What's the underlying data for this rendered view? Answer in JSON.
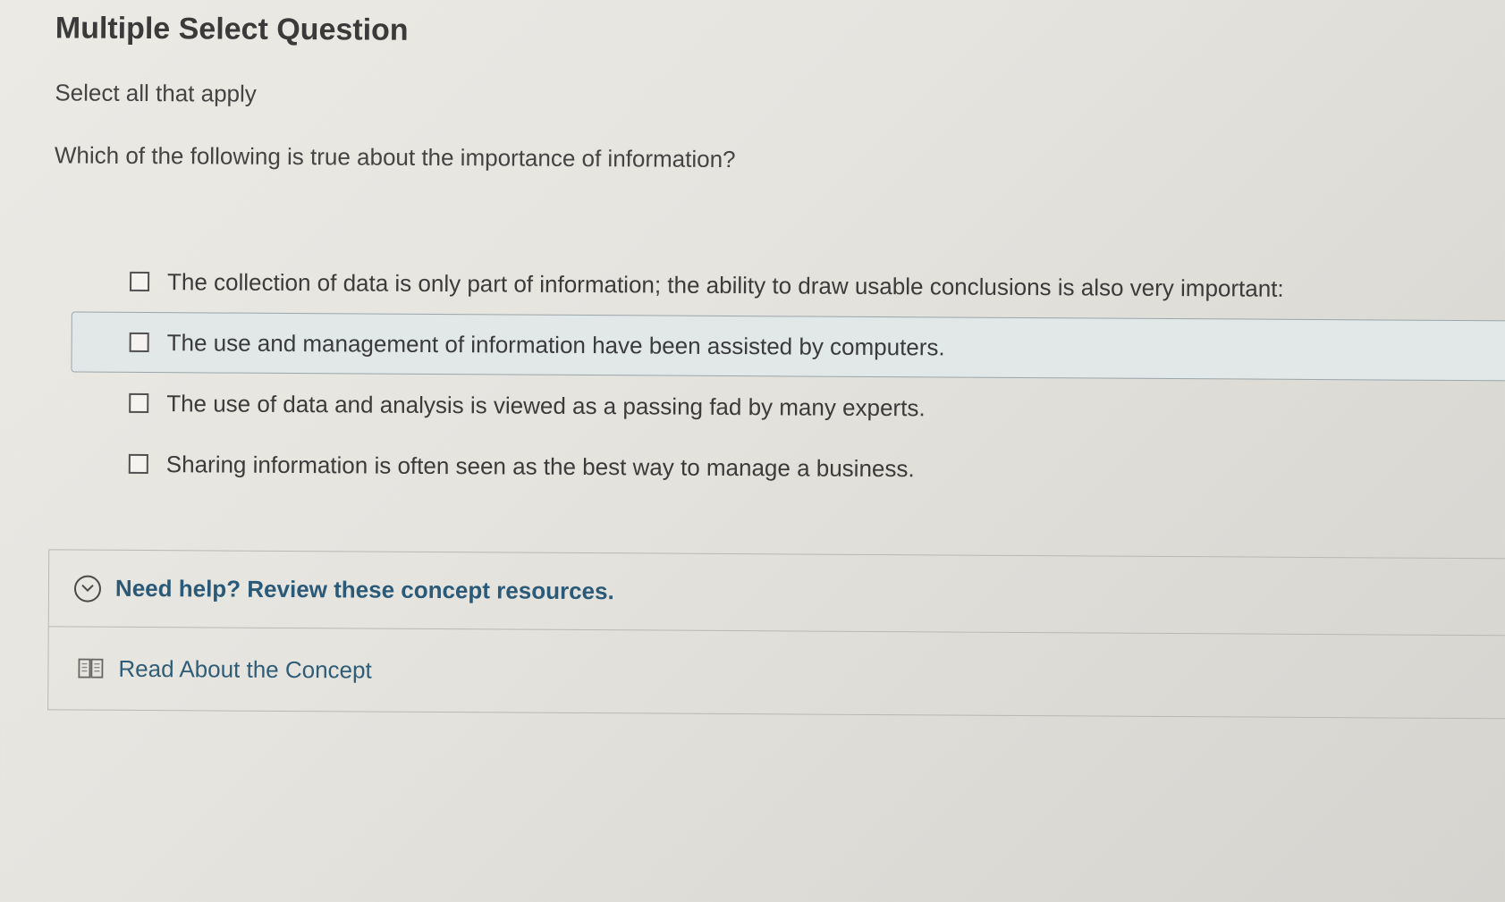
{
  "question": {
    "type_label": "Multiple Select Question",
    "instruction": "Select all that apply",
    "prompt": "Which of the following is true about the importance of information?"
  },
  "options": [
    {
      "label": "The collection of data is only part of information; the ability to draw usable conclusions is also very important:",
      "checked": false,
      "highlighted": false
    },
    {
      "label": "The use and management of information have been assisted by computers.",
      "checked": false,
      "highlighted": true
    },
    {
      "label": "The use of data and analysis is viewed as a passing fad by many experts.",
      "checked": false,
      "highlighted": false
    },
    {
      "label": "Sharing information is often seen as the best way to manage a business.",
      "checked": false,
      "highlighted": false
    }
  ],
  "help": {
    "title": "Need help? Review these concept resources.",
    "toggle_icon": "chevron-down-circle-icon",
    "resources": [
      {
        "label": "Read About the Concept",
        "icon": "book-icon"
      }
    ]
  },
  "colors": {
    "link": "#2a5a78",
    "highlight_bg": "#e2e7e7",
    "highlight_border": "#9aa6ab"
  }
}
